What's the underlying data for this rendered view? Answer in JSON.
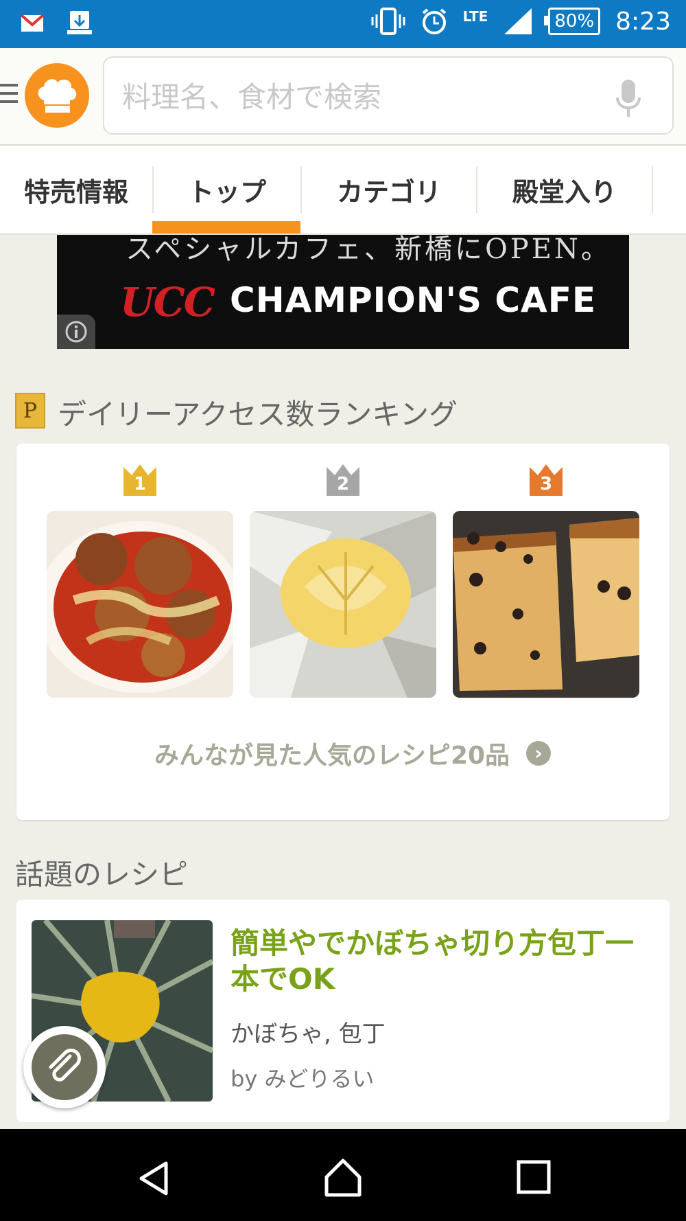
{
  "status_bar": {
    "battery": "80%",
    "network": "LTE",
    "time": "8:23"
  },
  "search": {
    "placeholder": "料理名、食材で検索"
  },
  "tabs": [
    "特売情報",
    "トップ",
    "カテゴリ",
    "殿堂入り"
  ],
  "ad": {
    "top_text": "スペシャルカフェ、新橋にOPEN。",
    "brand": "UCC",
    "name": "CHAMPION'S CAFE"
  },
  "ranking": {
    "badge": "P",
    "title": "デイリーアクセス数ランキング",
    "ranks": [
      "1",
      "2",
      "3"
    ],
    "more_label": "みんなが見た人気のレシピ20品",
    "crown_colors": [
      "#e8b52e",
      "#a6a6a6",
      "#e5792c"
    ]
  },
  "topics": {
    "title": "話題のレシピ",
    "recipe": {
      "title": "簡単やでかぼちゃ切り方包丁一本でOK",
      "ingredients": "かぼちゃ, 包丁",
      "author": "by みどりるい"
    }
  },
  "colors": {
    "status_bar": "#0e7ac4",
    "accent": "#f7921e",
    "recipe_title": "#7aa219"
  }
}
